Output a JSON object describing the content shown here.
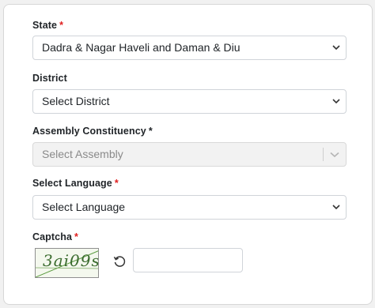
{
  "form": {
    "state": {
      "label": "State",
      "required_mark": "*",
      "value": "Dadra & Nagar Haveli and Daman & Diu"
    },
    "district": {
      "label": "District",
      "value": "Select District"
    },
    "assembly": {
      "label": "Assembly Constituency",
      "required_mark": "*",
      "value": "Select Assembly"
    },
    "language": {
      "label": "Select Language",
      "required_mark": "*",
      "value": "Select Language"
    },
    "captcha": {
      "label": "Captcha",
      "required_mark": "*",
      "image_text": "3ai09s",
      "input_value": ""
    }
  },
  "icons": {
    "select_chevron": "chevron-down-icon",
    "refresh": "refresh-icon"
  },
  "colors": {
    "required": "#e02020",
    "card_bg": "#ffffff",
    "page_bg": "#f1f1f1",
    "disabled_bg": "#f2f2f2"
  }
}
